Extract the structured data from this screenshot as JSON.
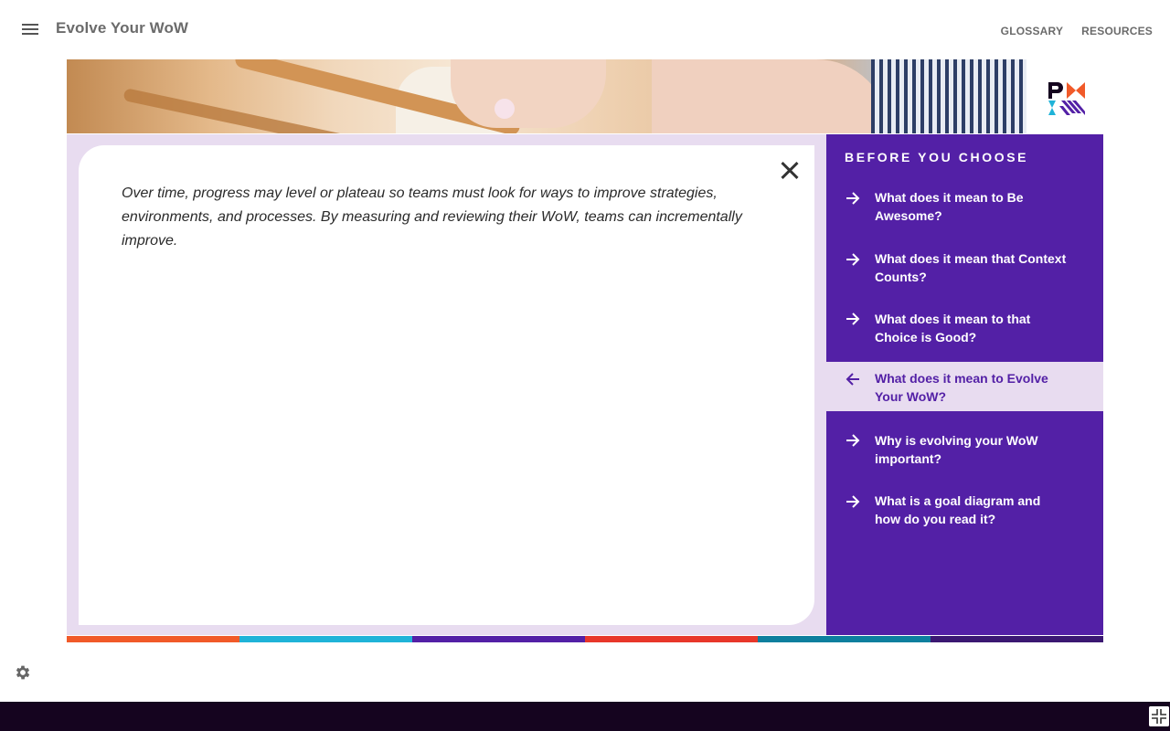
{
  "header": {
    "app_title": "Evolve Your WoW",
    "nav": [
      {
        "label": "GLOSSARY"
      },
      {
        "label": "RESOURCES"
      }
    ]
  },
  "content": {
    "body_text": "Over time, progress may level or plateau so teams must look for ways to improve strategies, environments, and processes. By measuring and reviewing their WoW, teams can incrementally improve."
  },
  "sidebar": {
    "title": "BEFORE YOU CHOOSE",
    "items": [
      {
        "label": "What does it mean to Be Awesome?",
        "icon": "arrow-right-icon",
        "active": false
      },
      {
        "label": "What does it mean that Context Counts?",
        "icon": "arrow-right-icon",
        "active": false
      },
      {
        "label": "What does it mean to that Choice is Good?",
        "icon": "arrow-right-icon",
        "active": false
      },
      {
        "label": "What does it mean to Evolve Your WoW?",
        "icon": "arrow-left-icon",
        "active": true
      },
      {
        "label": "Why is evolving your WoW important?",
        "icon": "arrow-right-icon",
        "active": false
      },
      {
        "label": "What is a goal diagram and how do you read it?",
        "icon": "arrow-right-icon",
        "active": false
      }
    ]
  },
  "colors": {
    "accent_purple": "#5320a6",
    "light_lavender": "#e8dcf0",
    "strip": [
      "#f15a29",
      "#1fb3d8",
      "#5320a6",
      "#e8372a",
      "#0d7f9e",
      "#3b1872"
    ],
    "bottom_bar": "#15041f"
  },
  "icons": {
    "menu": "hamburger-icon",
    "close": "close-icon",
    "settings": "gear-icon",
    "collapse": "collapse-fullscreen-icon",
    "logo": "pmi-logo"
  }
}
